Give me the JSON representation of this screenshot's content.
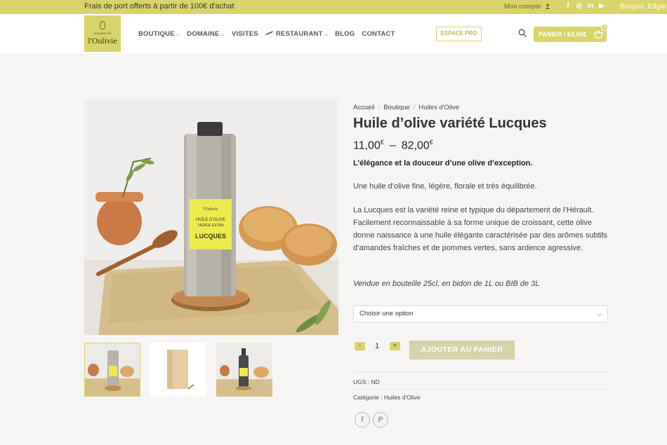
{
  "topbar": {
    "promo": "Frais de port offerts à partir de 100€ d'achat",
    "account": "Mon compte",
    "socials": [
      "facebook-icon",
      "instagram-icon",
      "linkedin-icon",
      "youtube-icon"
    ],
    "greeting": "Bonjour, Edgar"
  },
  "header": {
    "logo_small": "DOMAINE DE",
    "logo_big": "l'Oulivie",
    "nav": [
      {
        "label": "BOUTIQUE",
        "dropdown": true
      },
      {
        "label": "DOMAINE",
        "dropdown": true
      },
      {
        "label": "VISITES",
        "dropdown": false
      },
      {
        "label": "RESTAURANT",
        "dropdown": true
      },
      {
        "label": "BLOG",
        "dropdown": false
      },
      {
        "label": "CONTACT",
        "dropdown": false
      }
    ],
    "espace_pro": "ESPACE PRO",
    "cart_label": "PANIER / 63,00€",
    "cart_count": "3"
  },
  "product": {
    "breadcrumb": [
      "Accueil",
      "Boutique",
      "Huiles d'Olive"
    ],
    "title": "Huile d’olive variété Lucques",
    "price_min": "11,00",
    "price_max": "82,00",
    "currency": "€",
    "tagline": "L’élégance et la douceur d’une olive d’exception.",
    "desc1": "Une huile d’olive fine, légère, florale et très équilibrée.",
    "desc2": "La Lucques est la variété reine et typique du département de l’Hérault. Facilement reconnaissable à sa forme unique de croissant, cette olive donne naissance à une huile élégante caractérisée par des arômes subtils d’amandes fraîches et de pommes vertes, sans ardence agressive.",
    "sold": "Vendue en bouteille 25cl, en bidon de 1L ou BIB de 3L",
    "select_placeholder": "Choisir une option",
    "qty_minus": "-",
    "qty_value": "1",
    "qty_plus": "+",
    "add_to_cart": "AJOUTER AU PANIER",
    "sku": "UGS : ND",
    "category": "Catégorie : Huiles d'Olive",
    "label_line1": "l'Oulivie",
    "label_line2": "HUILE D'OLIVE",
    "label_line3": "VIERGE EXTRA",
    "label_name": "LUCQUES",
    "share": [
      "facebook-share-icon",
      "pinterest-share-icon"
    ]
  },
  "colors": {
    "accent": "#d8d36a",
    "add_cart_bg": "#d6d3a8"
  }
}
